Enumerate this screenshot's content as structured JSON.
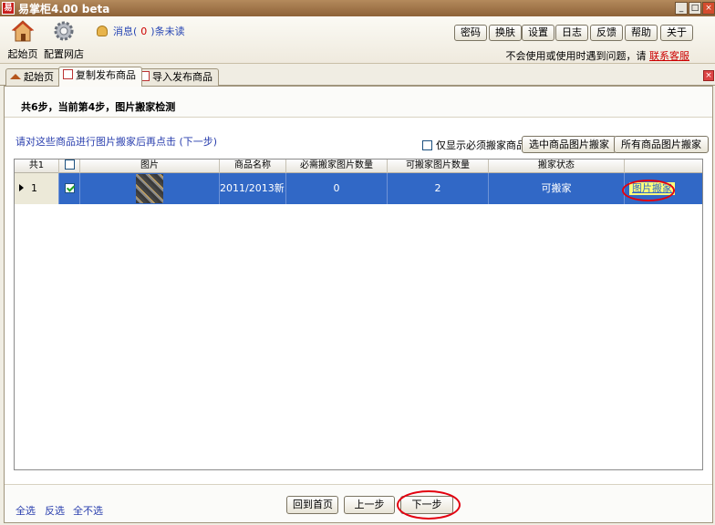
{
  "window": {
    "title": "易掌柜4.00 beta",
    "app_icon": "易",
    "controls": [
      "_",
      "□",
      "×"
    ]
  },
  "toolbar": {
    "home_label": "起始页",
    "config_label": "配置网店",
    "message_prefix": "消息(",
    "message_count": "0",
    "message_suffix": ")条未读",
    "buttons": [
      "密码",
      "换肤",
      "设置",
      "日志",
      "反馈",
      "帮助",
      "关于"
    ],
    "hint_text": "不会使用或使用时遇到问题，请",
    "hint_link": "联系客服"
  },
  "tabs": [
    {
      "label": "起始页",
      "icon": "home-icon"
    },
    {
      "label": "复制发布商品",
      "icon": "document-icon"
    },
    {
      "label": "导入发布商品",
      "icon": "document-icon"
    }
  ],
  "tab_close": "×",
  "step": {
    "text": "共6步，当前第4步，图片搬家检测"
  },
  "instruction": "请对这些商品进行图片搬家后再点击 (下一步)",
  "filter": {
    "checkbox_label": "仅显示必须搬家商品",
    "selected_button": "选中商品图片搬家",
    "all_button": "所有商品图片搬家"
  },
  "table": {
    "headers": [
      "共1",
      "",
      "图片",
      "商品名称",
      "必需搬家图片数量",
      "可搬家图片数量",
      "搬家状态",
      ""
    ],
    "rows": [
      {
        "index": "1",
        "checked": true,
        "name": "2011/2013新...",
        "required_count": "0",
        "movable_count": "2",
        "status": "可搬家",
        "action": "图片搬家"
      }
    ]
  },
  "bottom": {
    "select_all": "全选",
    "invert": "反选",
    "select_none": "全不选",
    "back_home": "回到首页",
    "prev": "上一步",
    "next": "下一步"
  },
  "colors": {
    "selection": "#3168c6",
    "annotation": "#e3000f",
    "link": "#2a3fae"
  }
}
